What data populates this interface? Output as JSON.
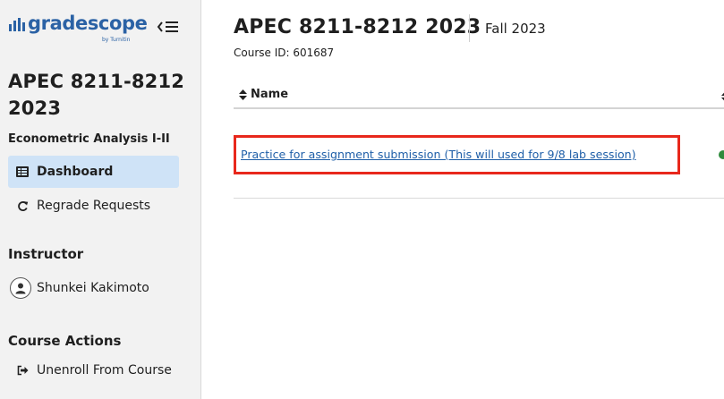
{
  "brand": {
    "name": "gradescope",
    "byline": "by Turnitin",
    "color": "#2b62a5"
  },
  "sidebar": {
    "course_title": "APEC 8211-8212 2023",
    "course_subtitle": "Econometric Analysis I-II",
    "nav": [
      {
        "label": "Dashboard",
        "icon": "dashboard-icon",
        "active": true
      },
      {
        "label": "Regrade Requests",
        "icon": "refresh-icon",
        "active": false
      }
    ],
    "instructor_heading": "Instructor",
    "instructor_name": "Shunkei Kakimoto",
    "actions_heading": "Course Actions",
    "actions": [
      {
        "label": "Unenroll From Course",
        "icon": "sign-out-icon"
      }
    ]
  },
  "main": {
    "title": "APEC 8211-8212 2023",
    "term": "Fall 2023",
    "course_id": "Course ID: 601687",
    "table": {
      "name_header": "Name",
      "rows": [
        {
          "name": "Practice for assignment submission (This will used for 9/8 lab session)",
          "status_color": "#2e8b3d"
        }
      ]
    },
    "highlight_color": "#e8281c",
    "link_color": "#1f5fa8"
  }
}
